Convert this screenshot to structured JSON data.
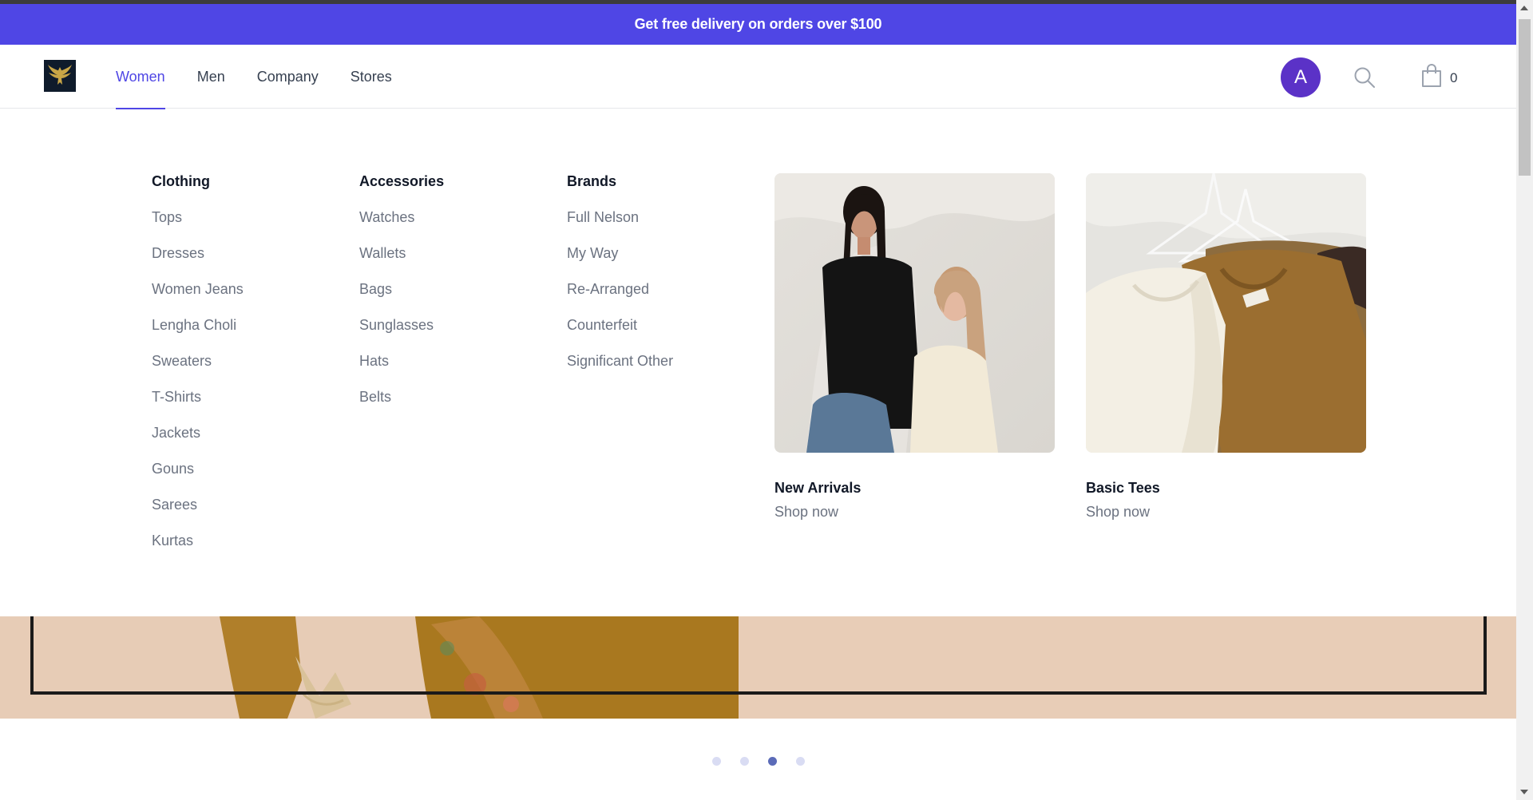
{
  "promo": {
    "text": "Get free delivery on orders over $100"
  },
  "header": {
    "nav": [
      {
        "label": "Women",
        "active": true
      },
      {
        "label": "Men"
      },
      {
        "label": "Company"
      },
      {
        "label": "Stores"
      }
    ],
    "avatar_initial": "A",
    "cart_count": "0",
    "icons": {
      "logo": "eagle-logo",
      "search": "search-icon",
      "cart": "shopping-bag-icon"
    }
  },
  "menu": {
    "clothing": {
      "title": "Clothing",
      "items": [
        "Tops",
        "Dresses",
        "Women Jeans",
        "Lengha Choli",
        "Sweaters",
        "T-Shirts",
        "Jackets",
        "Gouns",
        "Sarees",
        "Kurtas"
      ]
    },
    "accessories": {
      "title": "Accessories",
      "items": [
        "Watches",
        "Wallets",
        "Bags",
        "Sunglasses",
        "Hats",
        "Belts"
      ]
    },
    "brands": {
      "title": "Brands",
      "items": [
        "Full Nelson",
        "My Way",
        "Re-Arranged",
        "Counterfeit",
        "Significant Other"
      ]
    },
    "featured": [
      {
        "name": "New Arrivals",
        "cta": "Shop now"
      },
      {
        "name": "Basic Tees",
        "cta": "Shop now"
      }
    ]
  },
  "carousel": {
    "count": 4,
    "active_index": 2
  },
  "colors": {
    "accent": "#4f46e5",
    "avatar": "#5b32c7",
    "hero_bg": "#e8cdb7"
  }
}
